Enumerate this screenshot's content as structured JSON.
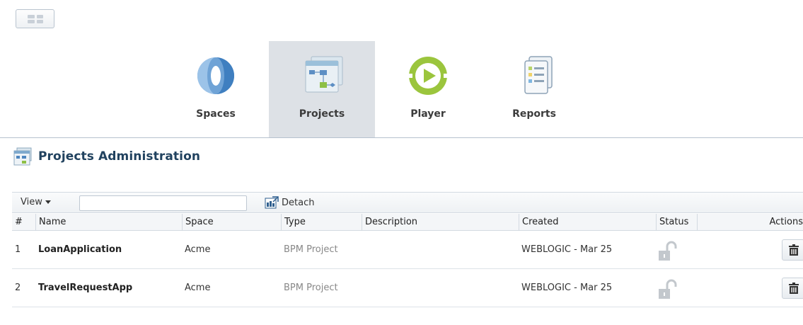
{
  "nav": {
    "tabs": [
      {
        "label": "Spaces",
        "icon": "spaces-icon",
        "active": false
      },
      {
        "label": "Projects",
        "icon": "projects-icon",
        "active": true
      },
      {
        "label": "Player",
        "icon": "player-icon",
        "active": false
      },
      {
        "label": "Reports",
        "icon": "reports-icon",
        "active": false
      }
    ]
  },
  "page": {
    "title": "Projects Administration"
  },
  "toolbar": {
    "view_label": "View",
    "search_value": "",
    "detach_label": "Detach"
  },
  "table": {
    "columns": [
      "#",
      "Name",
      "Space",
      "Type",
      "Description",
      "Created",
      "Status",
      "Actions"
    ],
    "rows": [
      {
        "num": "1",
        "name": "LoanApplication",
        "space": "Acme",
        "type": "BPM Project",
        "description": "",
        "created": "WEBLOGIC - Mar 25",
        "status": "unlocked-icon",
        "action": "trash-icon"
      },
      {
        "num": "2",
        "name": "TravelRequestApp",
        "space": "Acme",
        "type": "BPM Project",
        "description": "",
        "created": "WEBLOGIC - Mar 25",
        "status": "unlocked-icon",
        "action": "trash-icon"
      }
    ]
  },
  "colors": {
    "accent_title": "#21425f",
    "player_green": "#9bc53d",
    "spaces_blue": "#6fa3d6"
  }
}
